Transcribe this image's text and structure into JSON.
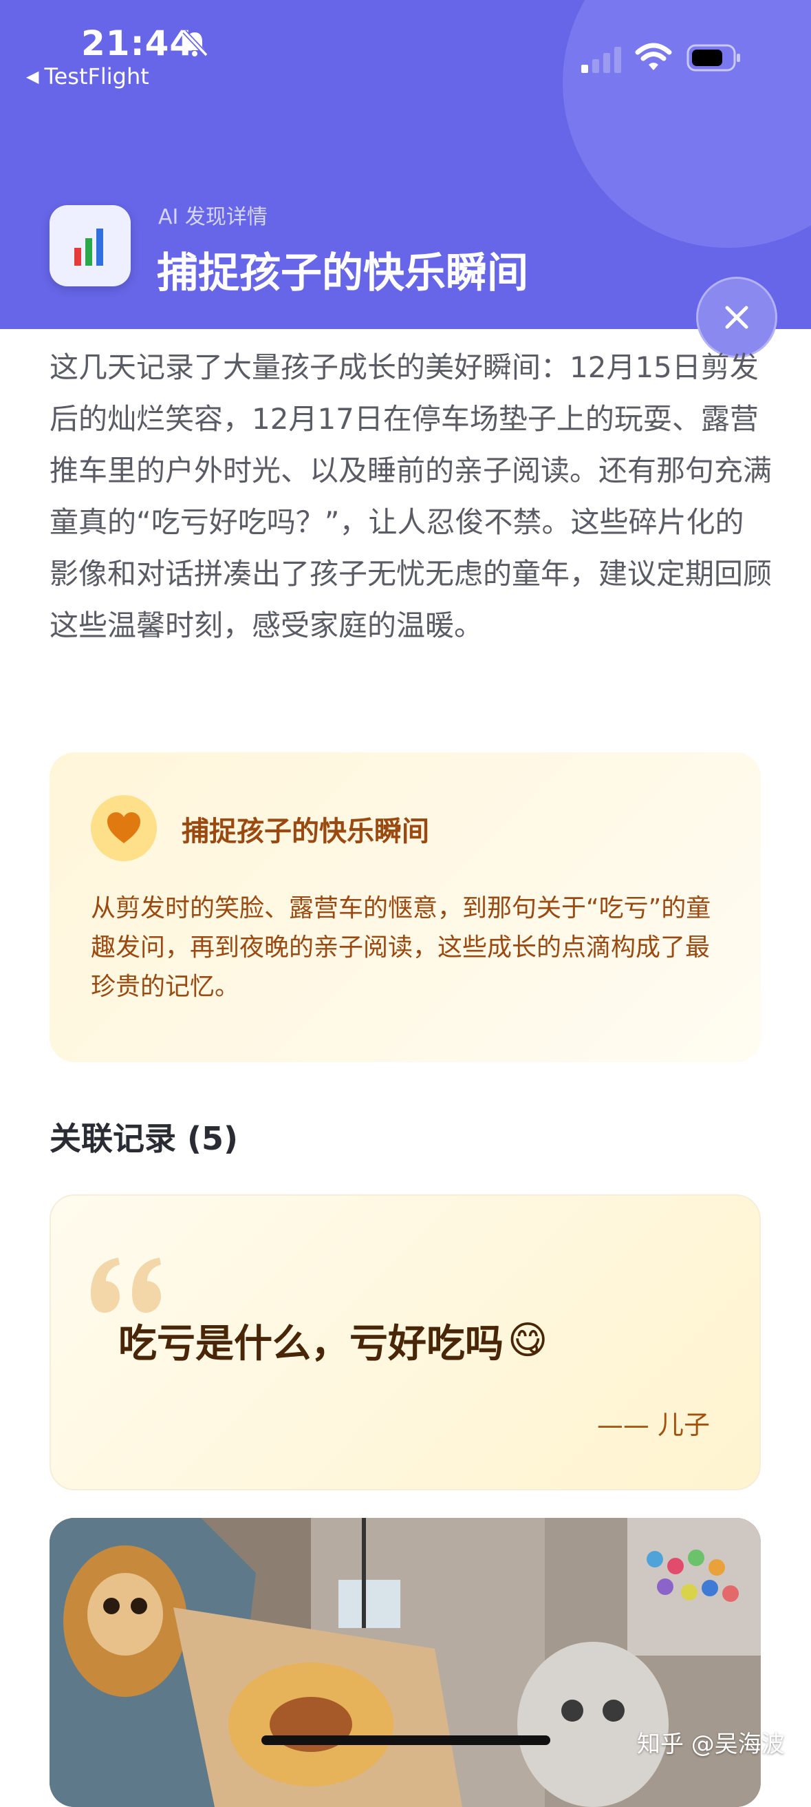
{
  "status_bar": {
    "time": "21:44",
    "back_app": "TestFlight"
  },
  "header": {
    "subtitle": "AI 发现详情",
    "title": "捕捉孩子的快乐瞬间"
  },
  "intro_text": "这几天记录了大量孩子成长的美好瞬间：12月15日剪发后的灿烂笑容，12月17日在停车场垫子上的玩耍、露营推车里的户外时光、以及睡前的亲子阅读。还有那句充满童真的“吃亏好吃吗？”，让人忍俊不禁。这些碎片化的影像和对话拼凑出了孩子无忧无虑的童年，建议定期回顾这些温馨时刻，感受家庭的温暖。",
  "highlight": {
    "title": "捕捉孩子的快乐瞬间",
    "body": "从剪发时的笑脸、露营车的惬意，到那句关于“吃亏”的童趣发问，再到夜晚的亲子阅读，这些成长的点滴构成了最珍贵的记忆。"
  },
  "related": {
    "title": "关联记录 (5)",
    "quote": {
      "text": "吃亏是什么，亏好吃吗",
      "emoji": "😋",
      "author": "—— 儿子"
    }
  },
  "watermark": "知乎 @吴海波",
  "colors": {
    "header_bg": "#6766E8",
    "highlight_text": "#9A4A10",
    "quote_text": "#4A2608"
  },
  "icons": [
    "bell-slash-icon",
    "signal-icon",
    "wifi-icon",
    "battery-icon",
    "bar-chart-icon",
    "close-icon",
    "heart-icon",
    "quote-mark-icon"
  ]
}
